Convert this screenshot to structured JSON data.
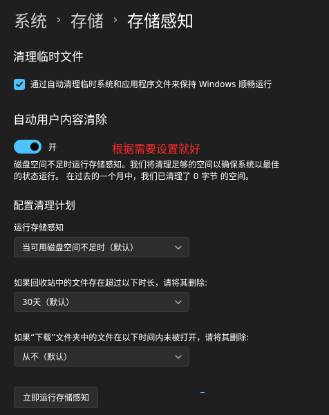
{
  "breadcrumb": {
    "items": [
      "系统",
      "存储",
      "存储感知"
    ],
    "separator": "›"
  },
  "temp_files": {
    "title": "清理临时文件",
    "checkbox_label": "通过自动清理临时系统和应用程序文件来保持 Windows 顺畅运行",
    "checked": true
  },
  "auto_cleanup": {
    "title": "自动用户内容清除",
    "toggle_state": "开",
    "toggle_on": true,
    "annotation": "根据需要设置就好",
    "description_line1": "磁盘空间不足时运行存储感知。我们将清理足够的空间以确保系统以最佳",
    "description_line2": "的状态运行。 在过去的一个月中，我们已清理了 0 字节 的空间。"
  },
  "schedule": {
    "title": "配置清理计划",
    "run_label": "运行存储感知",
    "run_value": "当可用磁盘空间不足时（默认）",
    "recycle_label": "如果回收站中的文件存在超过以下时长，请将其删除:",
    "recycle_value": "30天（默认）",
    "downloads_label": "如果“下载”文件夹中的文件在以下时间内未被打开，请将其删除:",
    "downloads_value": "从不（默认）"
  },
  "actions": {
    "run_now": "立即运行存储感知"
  },
  "colors": {
    "background": "#1f1f1f",
    "accent": "#4cc2ff",
    "annotation": "#ff2a2a",
    "control_bg": "#2d2d2d"
  },
  "icons": {
    "checkbox": "checkmark-icon",
    "dropdown": "chevron-down-icon"
  }
}
